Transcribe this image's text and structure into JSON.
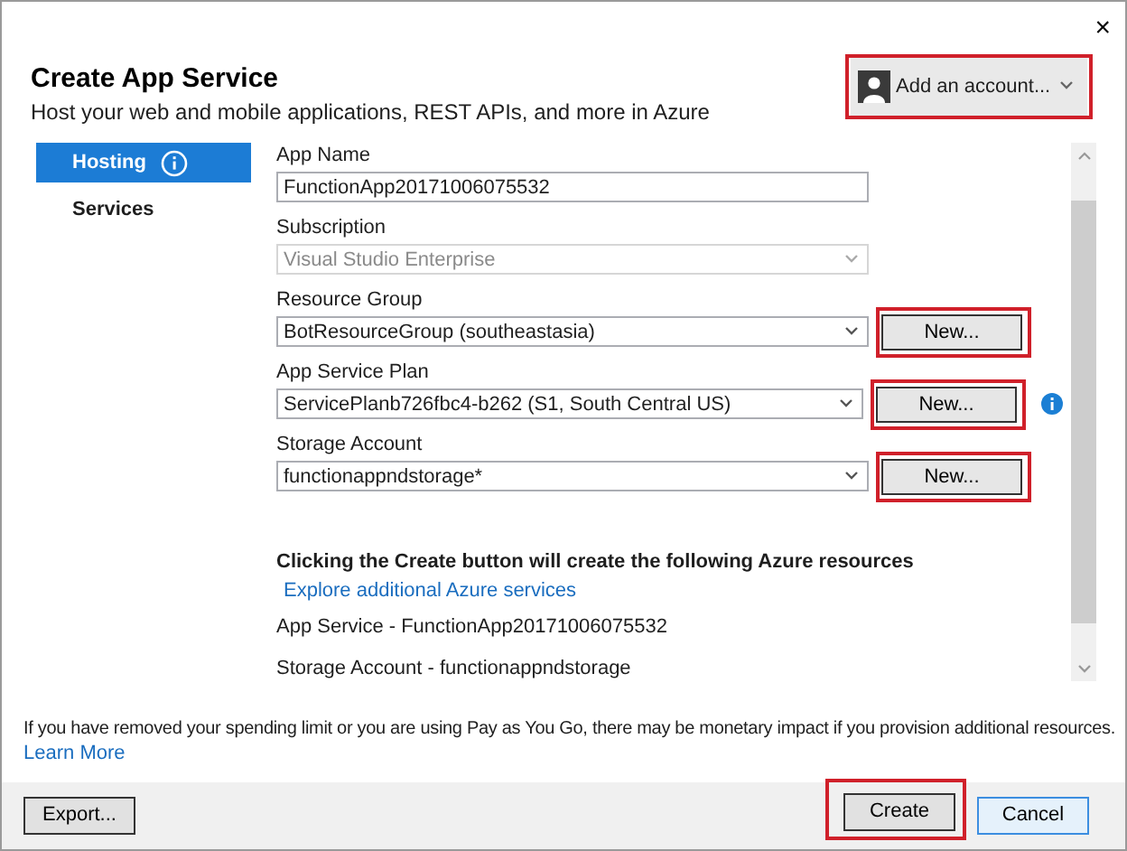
{
  "window": {
    "close": "×"
  },
  "account": {
    "label": "Add an account...",
    "highlighted": true
  },
  "title": "Create App Service",
  "subtitle": "Host your web and mobile applications, REST APIs, and more in Azure",
  "sidebar": {
    "items": [
      {
        "label": "Hosting",
        "selected": true,
        "info": true
      },
      {
        "label": "Services",
        "selected": false,
        "info": false
      }
    ]
  },
  "fields": [
    {
      "label": "App Name",
      "kind": "text",
      "value": "FunctionApp20171006075532"
    },
    {
      "label": "Subscription",
      "kind": "select",
      "value": "Visual Studio Enterprise",
      "disabled": true
    },
    {
      "label": "Resource Group",
      "kind": "select",
      "value": "BotResourceGroup (southeastasia)",
      "disabled": false,
      "button": {
        "label": "New...",
        "highlighted": true
      },
      "info": false
    },
    {
      "label": "App Service Plan",
      "kind": "select",
      "value": "ServicePlanb726fbc4-b262 (S1, South Central US)",
      "disabled": false,
      "button": {
        "label": "New...",
        "highlighted": true
      },
      "info": true
    },
    {
      "label": "Storage Account",
      "kind": "select",
      "value": "functionappndstorage*",
      "disabled": false,
      "button": {
        "label": "New...",
        "highlighted": true
      },
      "info": false
    }
  ],
  "summary": {
    "heading": "Clicking the Create button will create the following Azure resources",
    "link": "Explore additional Azure services",
    "lines": [
      "App Service - FunctionApp20171006075532",
      "Storage Account - functionappndstorage"
    ]
  },
  "notice": {
    "text": "If you have removed your spending limit or you are using Pay as You Go, there may be monetary impact if you provision additional resources.",
    "link": "Learn More"
  },
  "footer": {
    "buttons": [
      {
        "label": "Export...",
        "highlighted": false,
        "focused": false
      },
      {
        "label": "Create",
        "highlighted": true,
        "focused": false
      },
      {
        "label": "Cancel",
        "highlighted": false,
        "focused": true
      }
    ]
  }
}
